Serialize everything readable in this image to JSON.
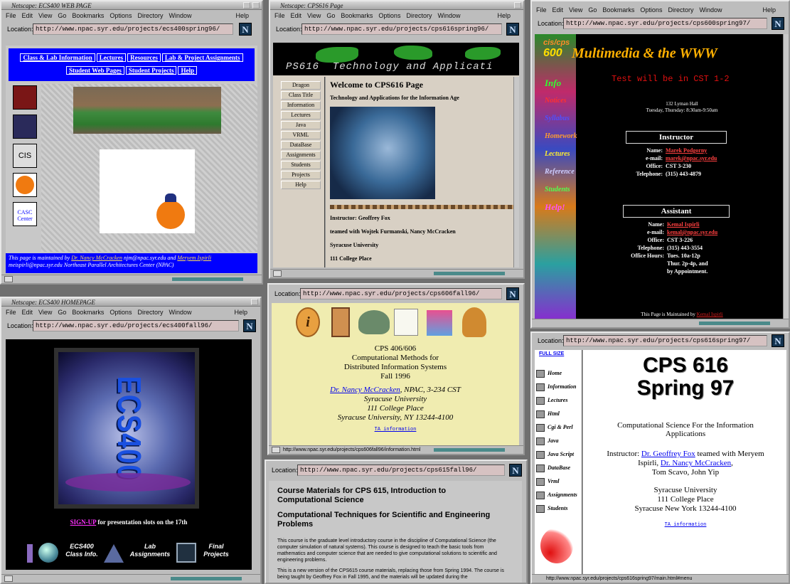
{
  "menu": [
    "File",
    "Edit",
    "View",
    "Go",
    "Bookmarks",
    "Options",
    "Directory",
    "Window"
  ],
  "help": "Help",
  "location_label": "Location:",
  "ecs400spring": {
    "title": "Netscape: ECS400 WEB PAGE",
    "url": "http://www.npac.syr.edu/projects/ecs400spring96/",
    "nav": [
      "Class & Lab Information",
      "Lectures",
      "Resources",
      "Lab & Project Assignments",
      "Student Web Pages",
      "Student Projects",
      "Help"
    ],
    "side_icons": [
      "syracuse-logo",
      "buildings-logo",
      "cis-logo",
      "orange-logo",
      "casc-logo"
    ],
    "cis": "CIS",
    "casc": "CASC Center",
    "footer_pre": "This page is maintained by ",
    "maint1": "Dr. Nancy McCracken",
    "email1": "njm@npac.syr.edu",
    "and": " and ",
    "maint2": "Meryem Ispirli",
    "email2": "meispirli@npac.syr.edu",
    "footer_post": " Northeast Parallel Architectures Center (NPAC)"
  },
  "cps616spring96": {
    "title": "Netscape: CPS616 Page",
    "url": "http://www.npac.syr.edu/projects/cps616spring96/",
    "banner": "PS616  Technology and Applicati",
    "buttons": [
      "Dragon",
      "Class Title",
      "Information",
      "Lectures",
      "Java",
      "VRML",
      "DataBase",
      "Assignments",
      "Students",
      "Projects",
      "Help"
    ],
    "heading": "Welcome to CPS616 Page",
    "subheading": "Technology and Applications for the Information Age",
    "instructor": "Instructor: Geoffrey Fox",
    "team": "teamed with Wojtek Furmanski, Nancy McCracken",
    "univ": "Syracuse University",
    "addr": "111 College Place"
  },
  "cps600": {
    "url": "http://www.npac.syr.edu/projects/cps600spring97/",
    "logo_line1": "cis/cps",
    "logo_num": "600",
    "logo_title": "Multimedia & the WWW",
    "test_notice": "Test will be in CST 1-2",
    "room": "132 Lyman Hall",
    "time": "Tuesday, Thursday: 8:30am-9:50am",
    "side": [
      "Info",
      "Notices",
      "Syllabus",
      "Homework",
      "Lectures",
      "Reference",
      "Students",
      "Help!"
    ],
    "instructor_title": "Instructor",
    "instructor": [
      {
        "k": "Name:",
        "v": "Marek Podgorny"
      },
      {
        "k": "e-mail:",
        "v": "marek@npac.syr.edu"
      },
      {
        "k": "Office:",
        "v": "CST 3-230"
      },
      {
        "k": "Telephone:",
        "v": "(315) 443-4879"
      }
    ],
    "assistant_title": "Assistant",
    "assistant": [
      {
        "k": "Name:",
        "v": "Kemal Ispirli"
      },
      {
        "k": "e-mail:",
        "v": "kemal@npac.syr.edu"
      },
      {
        "k": "Office:",
        "v": "CST 3-226"
      },
      {
        "k": "Telephone:",
        "v": "(315) 443-3554"
      },
      {
        "k": "Office Hours:",
        "v": "Tues. 10a-12p"
      }
    ],
    "hours2": "Thur. 2p-4p, and",
    "hours3": "by Appointment.",
    "footer": "This Page is Maintained by ",
    "footer_link": "Kemal Ispirli"
  },
  "ecs400fall": {
    "title": "Netscape: ECS400 HOMEPAGE",
    "url": "http://www.npac.syr.edu/projects/ecs400fall96/",
    "logo": "ECS400",
    "signup": "SIGN-UP",
    "signup_rest": " for presentation slots on the 17th",
    "footer": [
      "ECS400 Class Info.",
      "Lab Assignments",
      "Final Projects"
    ]
  },
  "cps606": {
    "url": "http://www.npac.syr.edu/projects/cps606fall96/",
    "l1": "CPS 406/606",
    "l2": "Computational Methods for",
    "l3": "Distributed Information Systems",
    "l4": "Fall 1996",
    "instructor": "Dr. Nancy McCracken",
    "office": ", NPAC, 3-234 CST",
    "univ": "Syracuse University",
    "addr": "111 College Place",
    "city": "Syracuse University, NY 13244-4100",
    "ta": "TA information",
    "status": "http://www.npac.syr.edu/projects/cps606fall96/information.html"
  },
  "cps615": {
    "url": "http://www.npac.syr.edu/projects/cps615fall96/",
    "h1": "Course Materials for CPS 615, Introduction to Computational Science",
    "h2": "Computational Techniques for Scientific and Engineering Problems",
    "p1": "This course is the graduate level introductory course in the discipline of Computational Science (the computer simulation of natural systems). This course is designed to teach the basic tools from mathematics and computer science that are needed to give computational solutions to scientific and engineering problems.",
    "p2": "This is a new version of the CPS615 course materials, replacing those from Spring 1994. The course is being taught by Geoffrey Fox in Fall 1995, and the materials will be updated during the"
  },
  "cps616spring97": {
    "url": "http://www.npac.syr.edu/projects/cps616spring97/",
    "fullsize": "FULL SIZE",
    "side": [
      "Home",
      "Information",
      "Lectures",
      "Html",
      "Cgi & Perl",
      "Java",
      "Java Script",
      "DataBase",
      "Vrml",
      "Assignments",
      "Students"
    ],
    "title1": "CPS 616",
    "title2": "Spring 97",
    "subtitle1": "Computational Science For the Information",
    "subtitle2": "Applications",
    "instr_pre": "Instructor: ",
    "instr_link": "Dr. Geoffrey Fox",
    "instr_mid": " teamed with Meryem",
    "instr_l2a": "Ispirli, ",
    "instr_link2": "Dr. Nancy McCracken",
    "instr_l2b": ",",
    "instr_l3": "Tom Scavo, John Yip",
    "univ": "Syracuse University",
    "addr": "111 College Place",
    "city": "Syracuse New York 13244-4100",
    "ta": "TA information",
    "status": "http://www.npac.syr.edu/projects/cps616spring97/main.html#menu"
  }
}
